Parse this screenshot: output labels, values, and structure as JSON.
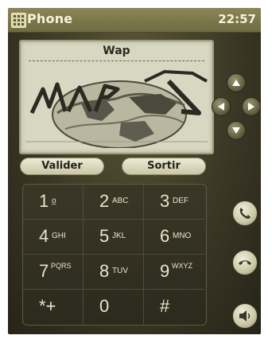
{
  "titlebar": {
    "app_title": "Phone",
    "clock": "22:57",
    "icon": "phone-app-icon"
  },
  "wap_screen": {
    "title": "Wap",
    "logo": "wap-globe-logo"
  },
  "dpad": {
    "icons": [
      "arrow-up-icon",
      "arrow-left-icon",
      "arrow-right-icon",
      "arrow-down-icon"
    ]
  },
  "softkeys": {
    "left_label": "Valider",
    "right_label": "Sortir"
  },
  "keypad": {
    "keys": [
      {
        "num": "1",
        "sub": "o̲"
      },
      {
        "num": "2",
        "sub": "ABC"
      },
      {
        "num": "3",
        "sub": "DEF"
      },
      {
        "num": "4",
        "sub": "GHI"
      },
      {
        "num": "5",
        "sub": "JKL"
      },
      {
        "num": "6",
        "sub": "MNO"
      },
      {
        "num": "7",
        "sub": "PQRS"
      },
      {
        "num": "8",
        "sub": "TUV"
      },
      {
        "num": "9",
        "sub": "WXYZ"
      },
      {
        "num": "*+",
        "sub": ""
      },
      {
        "num": "0",
        "sub": ""
      },
      {
        "num": "#",
        "sub": ""
      }
    ]
  },
  "side_buttons": {
    "icons": [
      "call-icon",
      "hang-up-icon",
      "speaker-icon"
    ]
  },
  "colors": {
    "background": "#3d3a2a",
    "titlebar": "#7a774b",
    "screen": "#d8d8c2",
    "key_text": "#e9e6cc"
  }
}
